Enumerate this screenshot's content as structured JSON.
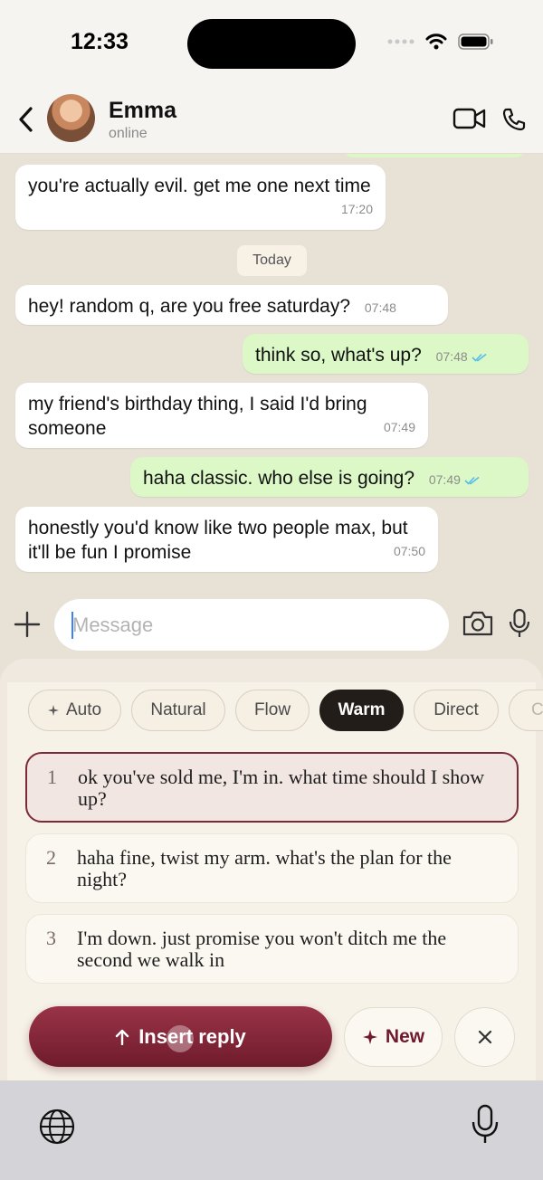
{
  "status_bar": {
    "time": "12:33"
  },
  "header": {
    "contact_name": "Emma",
    "contact_status": "online"
  },
  "chat": {
    "day_separator": "Today",
    "messages": [
      {
        "direction": "in",
        "text": "you're actually evil. get me one next time",
        "time": "17:20"
      },
      {
        "direction": "in",
        "text": "hey! random q, are you free saturday?",
        "time": "07:48"
      },
      {
        "direction": "out",
        "text": "think so, what's up?",
        "time": "07:48",
        "read": true
      },
      {
        "direction": "in",
        "text": "my friend's birthday thing, I said I'd bring someone",
        "time": "07:49"
      },
      {
        "direction": "out",
        "text": "haha classic. who else is going?",
        "time": "07:49",
        "read": true
      },
      {
        "direction": "in",
        "text": "honestly you'd know like two people max, but it'll be fun I promise",
        "time": "07:50"
      }
    ]
  },
  "input": {
    "placeholder": "Message"
  },
  "reply_panel": {
    "tones": [
      "Auto",
      "Natural",
      "Flow",
      "Warm",
      "Direct",
      "C"
    ],
    "active_tone": "Warm",
    "suggestions": [
      {
        "number": "1",
        "text": "ok you've sold me, I'm in. what time should I show up?",
        "selected": true
      },
      {
        "number": "2",
        "text": "haha fine, twist my arm. what's the plan for the night?",
        "selected": false
      },
      {
        "number": "3",
        "text": "I'm down. just promise you won't ditch me the second we walk in",
        "selected": false
      }
    ],
    "insert_label": "Insert reply",
    "new_label": "New"
  },
  "colors": {
    "accent": "#7b2a38",
    "outgoing_bubble": "#dcf8c6",
    "chat_bg": "#e8e1d6",
    "read_ticks": "#53bdeb"
  }
}
